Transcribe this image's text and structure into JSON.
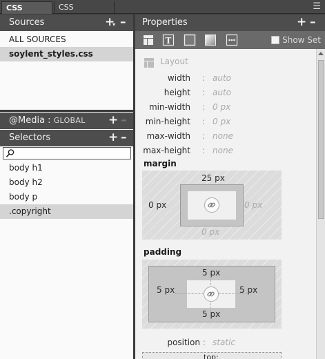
{
  "tabs": [
    {
      "label": "CSS Designer"
    },
    {
      "label": "CSS Transitions"
    }
  ],
  "sources": {
    "title": "Sources",
    "items": [
      "ALL SOURCES",
      "soylent_styles.css"
    ]
  },
  "media": {
    "title": "@Media :",
    "scope": "GLOBAL"
  },
  "selectors": {
    "title": "Selectors",
    "search_placeholder": "",
    "items": [
      "body h1",
      "body h2",
      "body p",
      ".copyright"
    ]
  },
  "properties": {
    "title": "Properties",
    "show_set_label": "Show Set",
    "show_set_checked": false,
    "layout_section": "Layout",
    "rows": [
      {
        "name": "width",
        "value": "auto"
      },
      {
        "name": "height",
        "value": "auto"
      },
      {
        "name": "min-width",
        "value": "0 px"
      },
      {
        "name": "min-height",
        "value": "0 px"
      },
      {
        "name": "max-width",
        "value": "none"
      },
      {
        "name": "max-height",
        "value": "none"
      }
    ],
    "margin": {
      "title": "margin",
      "top": "25 px",
      "right": "0 px",
      "bottom": "0 px",
      "left": "0 px"
    },
    "padding": {
      "title": "padding",
      "top": "5 px",
      "right": "5 px",
      "bottom": "5 px",
      "left": "5 px"
    },
    "position": {
      "name": "position",
      "value": "static"
    },
    "top_label": "top:"
  },
  "icons": {
    "add": "plus-icon",
    "remove": "minus-icon",
    "layout": "layout-icon",
    "text": "text-icon",
    "border": "border-icon",
    "background": "background-icon",
    "more": "more-icon",
    "search": "search-icon",
    "link": "link-icon"
  },
  "colors": {
    "panel_header": "#4d4d4d",
    "selected_row": "#d4d4d4",
    "toolbar": "#6a6a6a"
  }
}
